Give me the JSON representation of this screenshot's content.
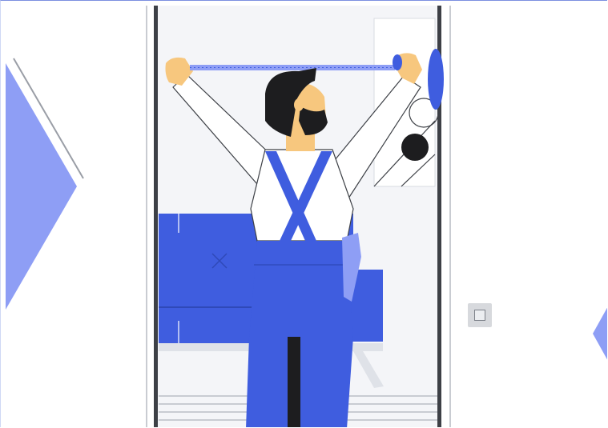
{
  "illustration": {
    "subject": "person-measuring-with-tape-icon",
    "accent_color": "#3f5ddf",
    "accent_light": "#8e9ef5",
    "skin_color": "#f7c77e",
    "hair_color": "#1d1d1f",
    "line_color": "#3d4046"
  },
  "controls": {
    "prev_slide": "chevron-left-icon",
    "next_slide": "chevron-right-icon",
    "toggle_box": "square-icon"
  }
}
